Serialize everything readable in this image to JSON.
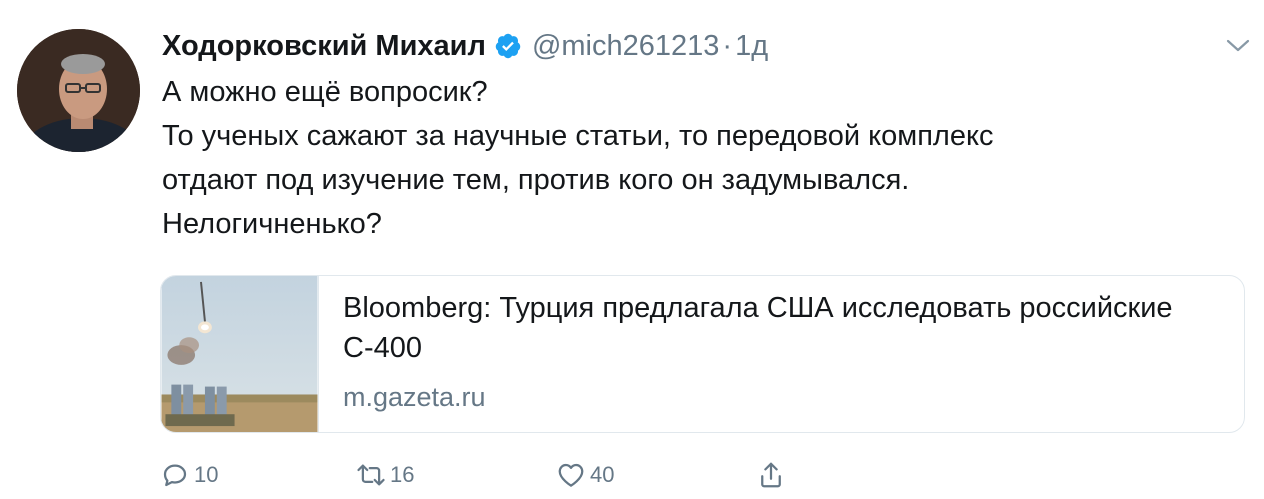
{
  "tweet": {
    "author_name": "Ходорковский Михаил",
    "handle": "@mich261213",
    "separator": "·",
    "time": "1д",
    "text_lines": [
      "А можно ещё вопросик?",
      "То ученых сажают за научные статьи, то передовой комплекс",
      "отдают под изучение тем, против кого он задумывался.",
      "Нелогичненько?"
    ]
  },
  "card": {
    "title": "Bloomberg: Турция предлагала США исследовать российские С-400",
    "domain": "m.gazeta.ru"
  },
  "actions": {
    "reply_count": "10",
    "retweet_count": "16",
    "like_count": "40"
  },
  "colors": {
    "accent": "#1da1f2",
    "secondary_text": "#657786",
    "primary_text": "#14171a",
    "border": "#e1e8ed"
  },
  "icons": [
    "verified-badge-icon",
    "chevron-down-icon",
    "reply-icon",
    "retweet-icon",
    "like-icon",
    "share-icon"
  ]
}
